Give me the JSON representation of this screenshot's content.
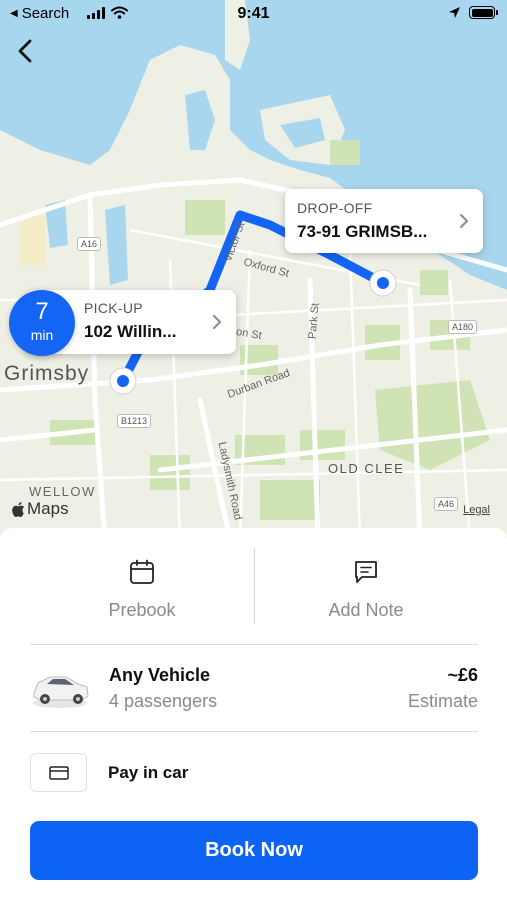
{
  "status_bar": {
    "back_app": "Search",
    "time": "9:41",
    "icons": [
      "back-triangle-icon",
      "signal-icon",
      "wifi-icon",
      "location-arrow-icon",
      "battery-icon"
    ]
  },
  "map": {
    "place_labels": {
      "grimsby": "Grimsby",
      "old_clee": "OLD CLEE",
      "wellow": "WELLOW",
      "oxford_st": "Oxford St",
      "victor_st": "Victor St",
      "on_st": "on St",
      "park_st": "Park St",
      "durban_road": "Durban Road",
      "ladysmith_road": "Ladysmith Road",
      "a16": "A16",
      "a180": "A180",
      "b1213": "B1213",
      "a46": "A46"
    },
    "eta": {
      "value": "7",
      "unit": "min"
    },
    "pickup": {
      "title": "PICK-UP",
      "address": "102 Willin..."
    },
    "dropoff": {
      "title": "DROP-OFF",
      "address": "73-91 GRIMSB..."
    },
    "attribution": "Maps",
    "legal": "Legal",
    "colors": {
      "water": "#a8d6ee",
      "route": "#1565f5",
      "land": "#eef0e6",
      "park": "#cfe3b4"
    }
  },
  "actions": {
    "prebook": {
      "label": "Prebook",
      "icon": "calendar-icon"
    },
    "add_note": {
      "label": "Add Note",
      "icon": "message-icon"
    }
  },
  "vehicle": {
    "name": "Any Vehicle",
    "passengers": "4 passengers",
    "price": "~£6",
    "price_note": "Estimate",
    "icon": "car-icon"
  },
  "payment": {
    "label": "Pay in car",
    "icon": "credit-card-icon"
  },
  "book_button": {
    "label": "Book Now",
    "color": "#0d63f3"
  }
}
